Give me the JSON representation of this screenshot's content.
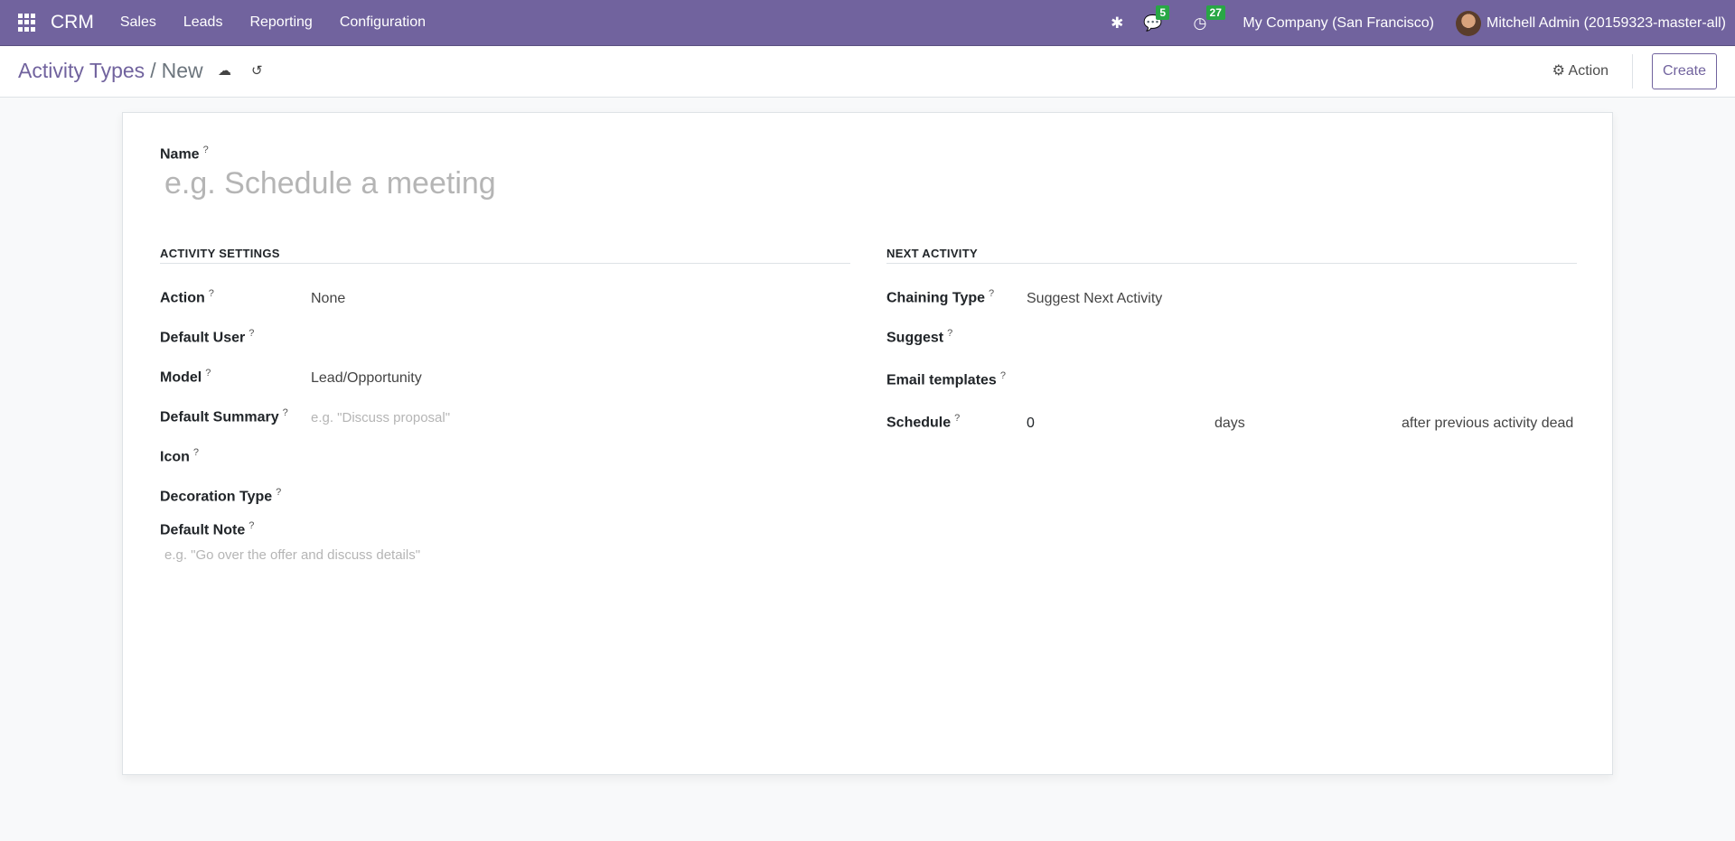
{
  "navbar": {
    "app": "CRM",
    "menu": [
      "Sales",
      "Leads",
      "Reporting",
      "Configuration"
    ],
    "messages_count": "5",
    "activities_count": "27",
    "company": "My Company (San Francisco)",
    "user": "Mitchell Admin (20159323-master-all)"
  },
  "control_panel": {
    "breadcrumb_parent": "Activity Types",
    "breadcrumb_sep": "/",
    "breadcrumb_current": "New",
    "action_label": "Action",
    "create_label": "Create"
  },
  "form": {
    "name_label": "Name",
    "name_placeholder": "e.g. Schedule a meeting",
    "help": "?",
    "activity_settings": {
      "title": "ACTIVITY SETTINGS",
      "action_label": "Action",
      "action_value": "None",
      "default_user_label": "Default User",
      "model_label": "Model",
      "model_value": "Lead/Opportunity",
      "summary_label": "Default Summary",
      "summary_placeholder": "e.g. \"Discuss proposal\"",
      "icon_label": "Icon",
      "decoration_label": "Decoration Type",
      "note_label": "Default Note",
      "note_placeholder": "e.g. \"Go over the offer and discuss details\""
    },
    "next_activity": {
      "title": "NEXT ACTIVITY",
      "chaining_label": "Chaining Type",
      "chaining_value": "Suggest Next Activity",
      "suggest_label": "Suggest",
      "email_label": "Email templates",
      "schedule_label": "Schedule",
      "schedule_value": "0",
      "schedule_unit": "days",
      "schedule_from": "after previous activity dead"
    }
  }
}
